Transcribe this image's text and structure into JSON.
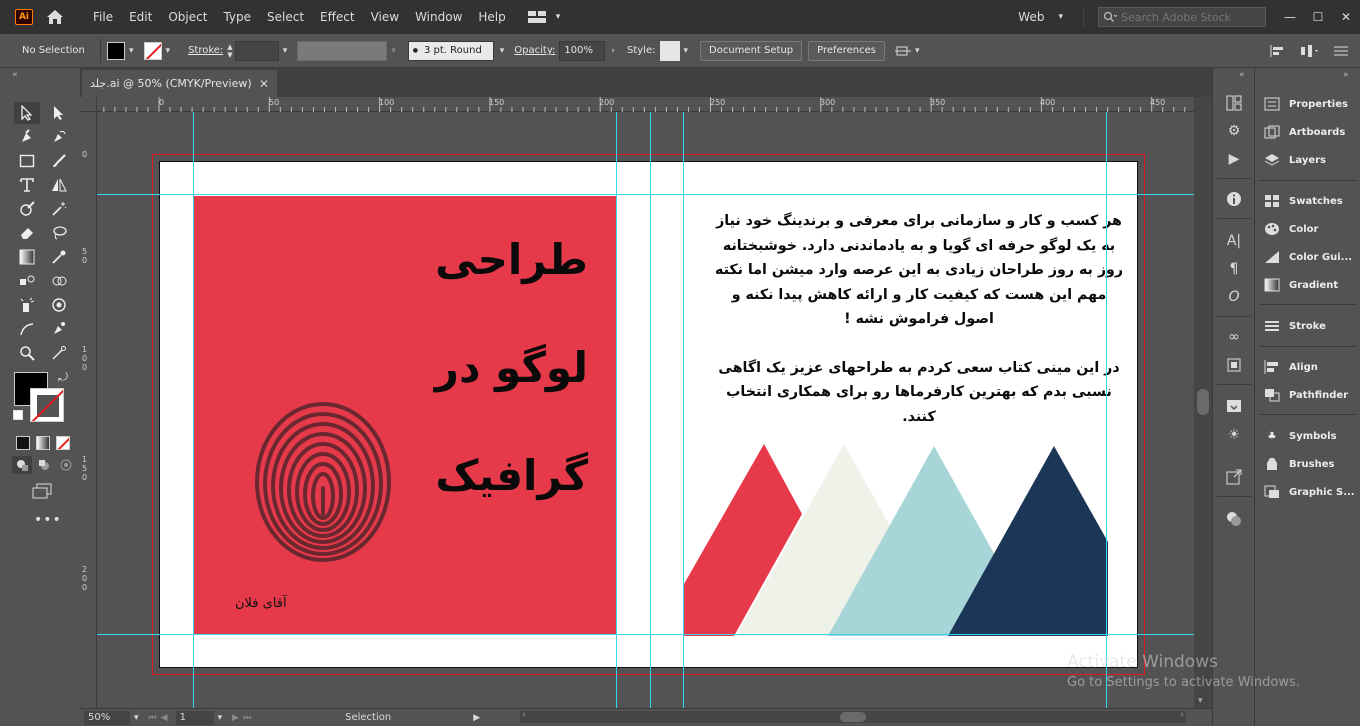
{
  "app": {
    "logo_text": "Ai"
  },
  "menu": {
    "items": [
      "File",
      "Edit",
      "Object",
      "Type",
      "Select",
      "Effect",
      "View",
      "Window",
      "Help"
    ],
    "workspace": "Web",
    "search_placeholder": "Search Adobe Stock"
  },
  "control_bar": {
    "selection_status": "No Selection",
    "stroke_label": "Stroke:",
    "brush_value": "3 pt. Round",
    "opacity_label": "Opacity:",
    "opacity_value": "100%",
    "style_label": "Style:",
    "document_setup": "Document Setup",
    "preferences": "Preferences"
  },
  "document": {
    "tab_title": "جلد.ai @ 50% (CMYK/Preview)"
  },
  "ruler": {
    "h_labels": [
      "0",
      "50",
      "100",
      "150",
      "200",
      "250",
      "300",
      "350",
      "400",
      "450"
    ],
    "v_labels": [
      "0",
      "5 0",
      "1 0 0",
      "1 5 0",
      "2 0 0"
    ]
  },
  "artwork": {
    "cover_title_lines": [
      "طراحی",
      "لوگو در",
      "گرافیک"
    ],
    "author": "آقای فلان",
    "body_paragraph_1": "هر کسب و کار و سازمانی برای معرفی و برندینگ خود نیاز به یک لوگو حرفه ای گویا  و به یادماندنی دارد. خوشبختانه روز به روز طراحان زیادی به این عرصه وارد میشن اما نکته مهم این هست که کیفیت کار و ارائه کاهش پیدا نکنه و اصول فراموش نشه !",
    "body_paragraph_2": "در این مینی کتاب سعی کردم به طراحهای عزیز یک اگاهی نسبی بدم که بهترین کارفرماها رو برای همکاری انتخاب کنند.",
    "colors": {
      "cover_red": "#e63a4a",
      "mountain_red": "#e63a4a",
      "mountain_cream": "#eef2e8",
      "mountain_teal": "#a8d5d8",
      "mountain_navy": "#1b3656",
      "guide": "#36d7ea",
      "bleed": "#e01b24"
    }
  },
  "status_bar": {
    "zoom": "50%",
    "artboard_number": "1",
    "tool_name": "Selection"
  },
  "panels": [
    {
      "label": "Properties",
      "icon": "properties-icon"
    },
    {
      "label": "Artboards",
      "icon": "artboards-icon"
    },
    {
      "label": "Layers",
      "icon": "layers-icon"
    },
    {
      "label": "Swatches",
      "icon": "swatches-icon"
    },
    {
      "label": "Color",
      "icon": "color-icon"
    },
    {
      "label": "Color Gui...",
      "icon": "color-guide-icon"
    },
    {
      "label": "Gradient",
      "icon": "gradient-icon"
    },
    {
      "label": "Stroke",
      "icon": "stroke-icon"
    },
    {
      "label": "Align",
      "icon": "align-icon"
    },
    {
      "label": "Pathfinder",
      "icon": "pathfinder-icon"
    },
    {
      "label": "Symbols",
      "icon": "symbols-icon"
    },
    {
      "label": "Brushes",
      "icon": "brushes-icon"
    },
    {
      "label": "Graphic S...",
      "icon": "graphic-styles-icon"
    }
  ],
  "watermark": {
    "line1": "Activate Windows",
    "line2": "Go to Settings to activate Windows."
  }
}
